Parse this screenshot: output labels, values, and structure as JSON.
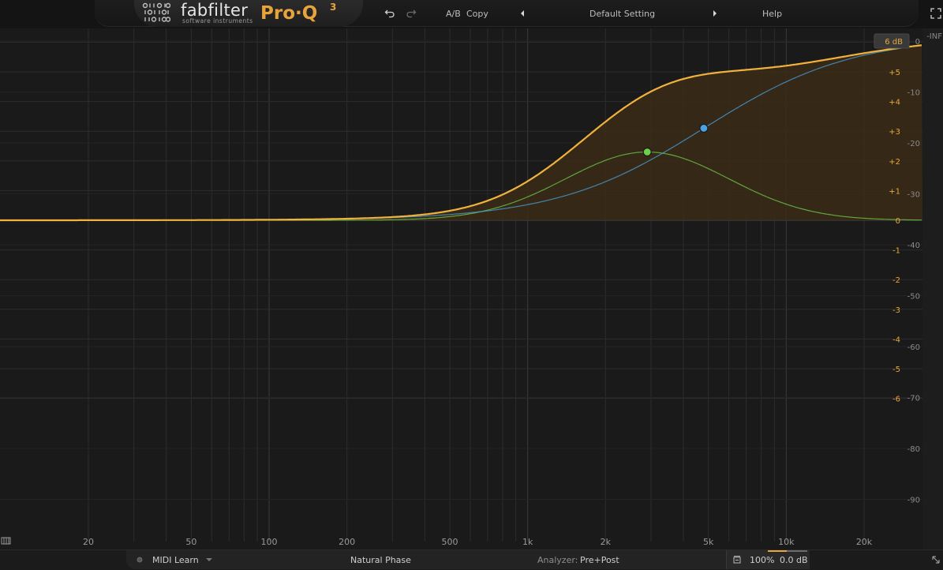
{
  "header": {
    "brand": "fabfilter",
    "brand_sub": "software instruments",
    "product": "Pro·Q",
    "product_version": "3",
    "ab_label": "A/B",
    "copy_label": "Copy",
    "preset_name": "Default Setting",
    "help_label": "Help",
    "icons": {
      "undo": "undo-icon",
      "redo": "redo-icon",
      "prev_preset": "arrow-left-icon",
      "next_preset": "arrow-right-icon",
      "fullscreen": "fullscreen-icon"
    }
  },
  "eq_graph": {
    "display_range_label": "6 dB",
    "gain_scale": [
      "+5",
      "+4",
      "+3",
      "+2",
      "+1",
      "0",
      "-1",
      "-2",
      "-3",
      "-4",
      "-5",
      "-6"
    ],
    "spectrum_scale": [
      "0",
      "-10",
      "-20",
      "-30",
      "-40",
      "-50",
      "-60",
      "-70",
      "-80",
      "-90"
    ],
    "spectrum_top_label": "-INF",
    "freq_labels": [
      "20",
      "50",
      "100",
      "200",
      "500",
      "1k",
      "2k",
      "5k",
      "10k",
      "20k"
    ],
    "bands": [
      {
        "type": "bell",
        "frequency_hz": 2900,
        "gain_db": 2.3,
        "color": "#6fcf4a"
      },
      {
        "type": "high-shelf",
        "frequency_hz": 4800,
        "gain_db": 3.1,
        "color": "#4aa3e0"
      }
    ],
    "colors": {
      "total_curve": "#f0b23c",
      "fill": "#3a2c16",
      "grid": "#2e2c2e",
      "grid_major": "#3c3a3c"
    }
  },
  "footer": {
    "midi_learn_label": "MIDI Learn",
    "phase_mode": "Natural Phase",
    "analyzer_label": "Analyzer:",
    "analyzer_value": "Pre+Post",
    "zoom": "100%",
    "output_gain": "0.0 dB",
    "icons": {
      "midi": "midi-keyboard-icon",
      "midi_dot": "midi-dot-icon",
      "dropdown": "chevron-down-icon",
      "output_options": "output-options-icon",
      "resize": "resize-icon"
    }
  }
}
